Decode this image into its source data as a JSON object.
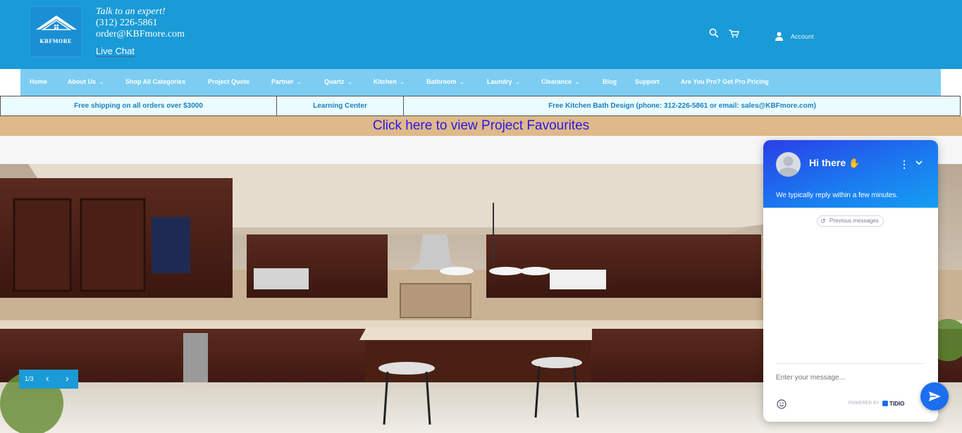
{
  "header": {
    "logo_text": "KBFMORE",
    "tagline": "Talk to an expert!",
    "phone": "(312) 226-5861",
    "email": "order@KBFmore.com",
    "live_chat": "Live Chat",
    "account_label": "Account"
  },
  "nav": {
    "items": [
      {
        "label": "Home"
      },
      {
        "label": "About Us"
      },
      {
        "label": "Shop All Categories"
      },
      {
        "label": "Project Quote"
      },
      {
        "label": "Partner"
      },
      {
        "label": "Quartz"
      },
      {
        "label": "Kitchen"
      },
      {
        "label": "Bathroom"
      },
      {
        "label": "Laundry"
      },
      {
        "label": "Clearance"
      },
      {
        "label": "Blog"
      },
      {
        "label": "Support"
      },
      {
        "label": "Are You Pro? Get Pro Pricing"
      }
    ]
  },
  "infobar": {
    "shipping": "Free shipping on all orders over $3000",
    "learning": "Learning Center",
    "design": "Free Kitchen Bath Design (phone: 312-226-5861 or email: sales@KBFmore.com)"
  },
  "favourites_link": "Click here to view Project Favourites",
  "slider": {
    "counter": "1/3",
    "prev": "‹",
    "next": "›"
  },
  "chat": {
    "title": "Hi there",
    "subtitle": "We typically reply within a few minutes.",
    "previous_messages": "Previous messages",
    "input_placeholder": "Enter your message...",
    "powered_by": "POWERED BY",
    "brand": "TIDIO"
  },
  "colors": {
    "header_bg": "#1a9ad6",
    "nav_bg": "#7dcdf2",
    "info_text": "#1c7fc0",
    "fav_bg": "#dfb98a",
    "fav_link": "#2b18e6",
    "chat_accent": "#1b6ef0"
  }
}
